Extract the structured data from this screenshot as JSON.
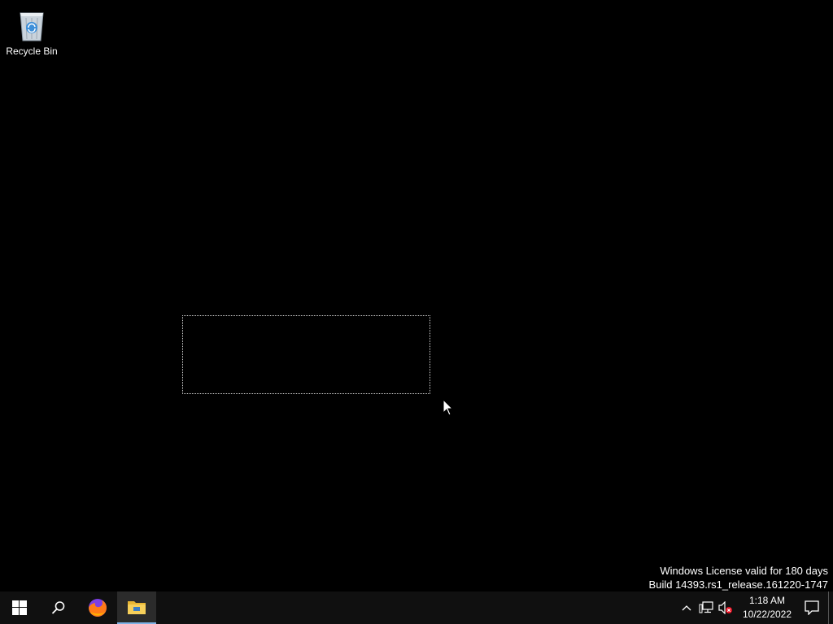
{
  "desktop": {
    "background_color": "#000000",
    "icons": [
      {
        "label": "Recycle Bin",
        "icon": "recycle-bin-icon"
      }
    ]
  },
  "watermark": {
    "line1": "Windows License valid for 180 days",
    "line2": "Build 14393.rs1_release.161220-1747"
  },
  "taskbar": {
    "start_icon": "windows-logo-icon",
    "search_icon": "search-icon",
    "pinned": [
      {
        "icon": "firefox-icon",
        "active": false
      },
      {
        "icon": "file-explorer-icon",
        "active": true
      }
    ],
    "tray": {
      "overflow_icon": "chevron-up-icon",
      "network_icon": "network-icon",
      "volume_icon": "volume-muted-icon",
      "time": "1:18 AM",
      "date": "10/22/2022",
      "notification_icon": "action-center-icon"
    },
    "accent_color": "#7fb2e5"
  }
}
